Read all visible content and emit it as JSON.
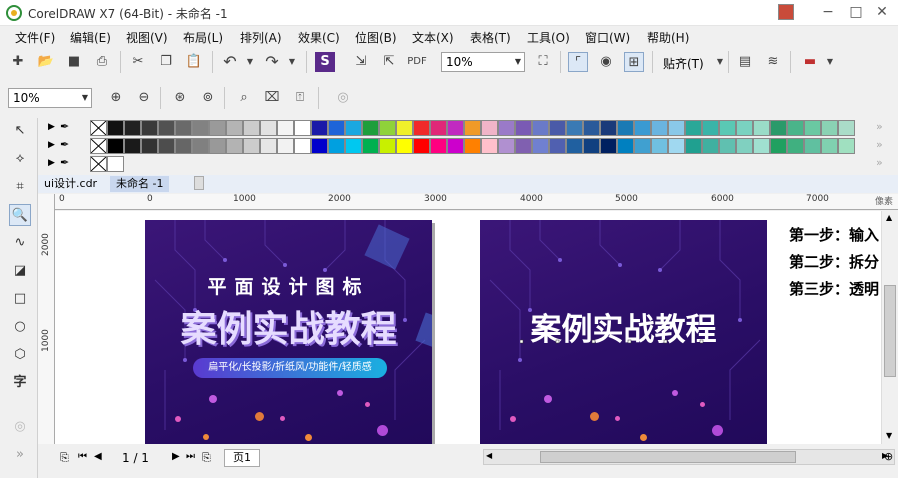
{
  "window": {
    "title": "CorelDRAW X7 (64-Bit) - 未命名 -1",
    "minimize": "−",
    "maximize": "□",
    "close": "✕"
  },
  "menu": [
    "文件(F)",
    "编辑(E)",
    "视图(V)",
    "布局(L)",
    "排列(A)",
    "效果(C)",
    "位图(B)",
    "文本(X)",
    "表格(T)",
    "工具(O)",
    "窗口(W)",
    "帮助(H)"
  ],
  "toolbar1": {
    "zoom_value": "10%",
    "snap_label": "贴齐(T)"
  },
  "toolbar2": {
    "zoom_value": "10%"
  },
  "palette": {
    "row1": [
      "#111111",
      "#222222",
      "#3a3a3a",
      "#525252",
      "#6a6a6a",
      "#828282",
      "#9a9a9a",
      "#b4b4b4",
      "#cccccc",
      "#e2e2e2",
      "#f4f4f4",
      "#ffffff",
      "#1a1aa8",
      "#1e64d8",
      "#1aa8e0",
      "#1e9e3c",
      "#8fd23a",
      "#f0f02a",
      "#f02a2a",
      "#e02878",
      "#c02ac0",
      "#f09a28",
      "#f0b4c8",
      "#9a7ac8",
      "#7a5ab4",
      "#6a7ac8",
      "#4a5aa8",
      "#3a7ab4",
      "#2a5a9a",
      "#1a3a7a",
      "#1a7ab4",
      "#3a9ad2",
      "#6ab4e0",
      "#8ac8e8",
      "#2aa898",
      "#3ab4a8",
      "#5ac8b4",
      "#7ad2c0",
      "#9adcc8",
      "#2a9a6a",
      "#4ab48a",
      "#6ac8a2",
      "#8ad2b4",
      "#aadcc8"
    ],
    "row2": [
      "#000000",
      "#1a1a1a",
      "#333333",
      "#4d4d4d",
      "#666666",
      "#808080",
      "#999999",
      "#b3b3b3",
      "#cccccc",
      "#e6e6e6",
      "#f2f2f2",
      "#ffffff",
      "#0000cc",
      "#00a0e0",
      "#00c8f0",
      "#00b050",
      "#c8f000",
      "#ffff00",
      "#ff0000",
      "#ff0080",
      "#cc00cc",
      "#ff8000",
      "#ffc0cb",
      "#b090d0",
      "#8060b0",
      "#7080d0",
      "#5060b0",
      "#2060a0",
      "#104080",
      "#002060",
      "#0080c0",
      "#40a0d0",
      "#70c0e0",
      "#a0d8f0",
      "#20a090",
      "#40b0a0",
      "#60c0b0",
      "#80d0c0",
      "#a0e0d0",
      "#20a060",
      "#40b080",
      "#60c0a0",
      "#80d0b0",
      "#a0e0c0"
    ]
  },
  "doc_tabs": [
    {
      "label": "ui设计.cdr"
    },
    {
      "label": "未命名 -1"
    }
  ],
  "rulers": {
    "h_labels": [
      "0",
      "1000",
      "2000",
      "3000",
      "4000",
      "5000",
      "6000",
      "7000"
    ],
    "v_labels": [
      "2000",
      "1000"
    ],
    "unit": "像素"
  },
  "artboards": [
    {
      "title_spaced": "平面设计图标",
      "main": "案例实战教程",
      "tagline": "扁平化/长投影/折纸风/功能件/轻质感"
    },
    {
      "main": "案例实战教程"
    }
  ],
  "steps": [
    "第一步：输入",
    "第二步：拆分",
    "第三步：透明"
  ],
  "status": {
    "page_count": "1 / 1",
    "page_tab": "页1"
  }
}
